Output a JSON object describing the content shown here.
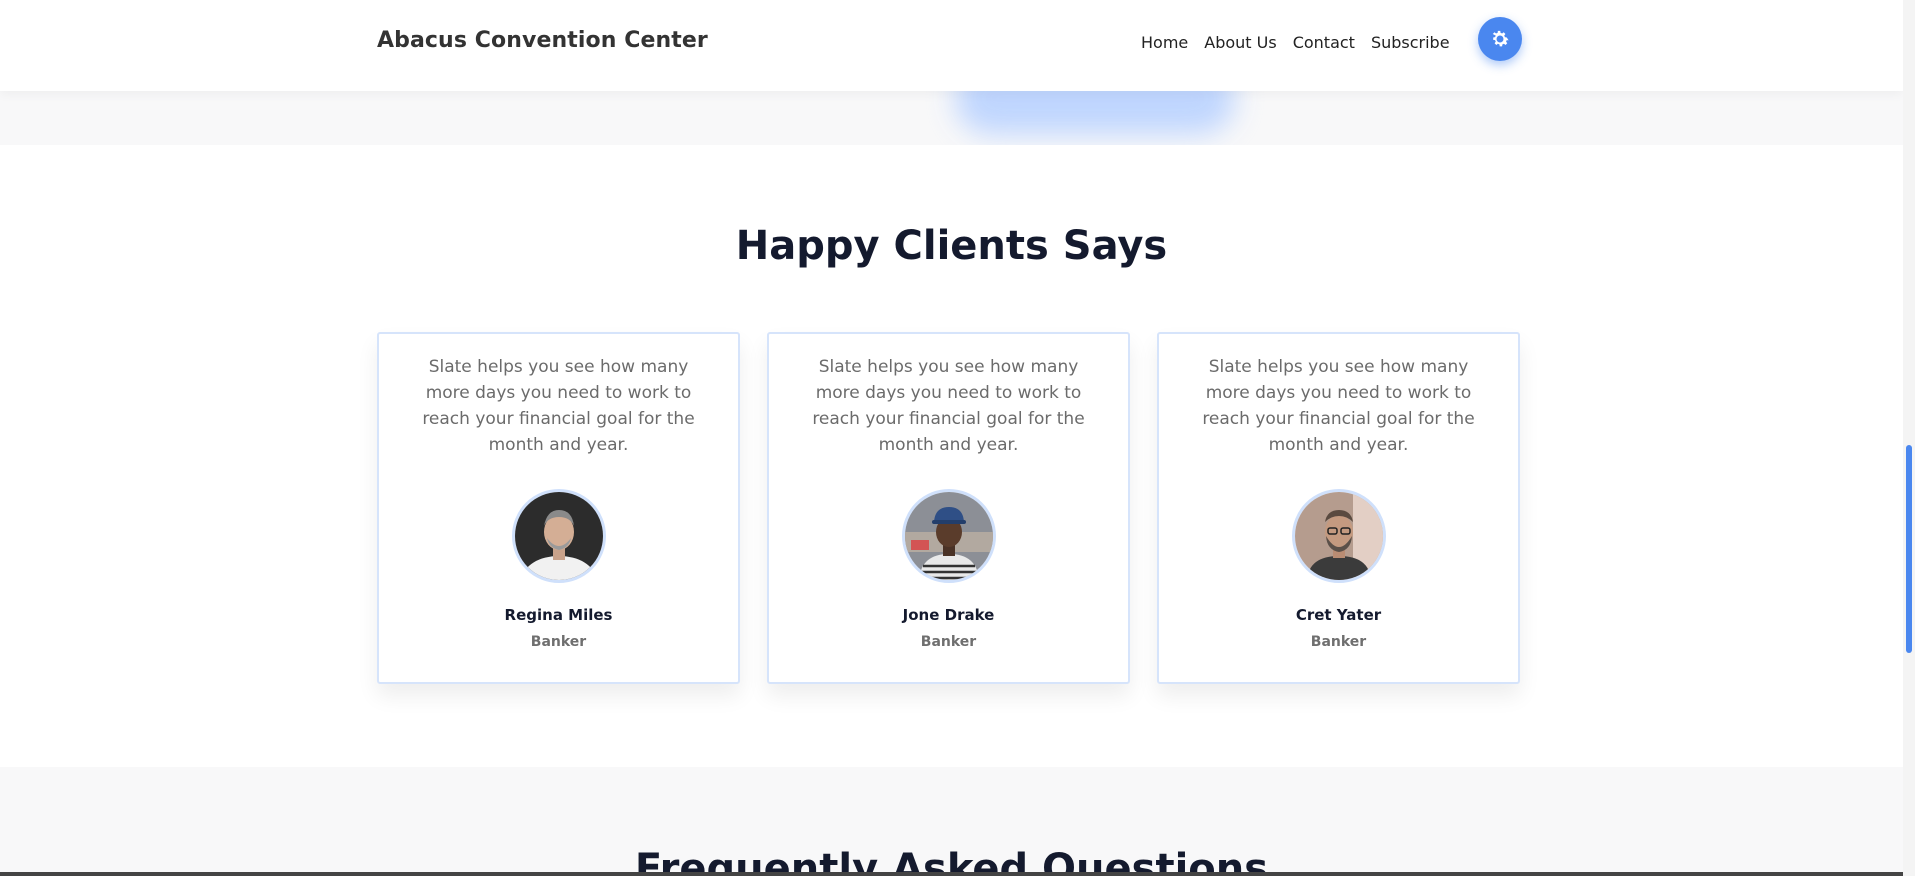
{
  "header": {
    "brand": "Abacus Convention Center",
    "nav": [
      "Home",
      "About Us",
      "Contact",
      "Subscribe"
    ],
    "theme_toggle_icon": "gear-icon",
    "accent_color": "#4a87ef"
  },
  "testimonials": {
    "title": "Happy Clients Says",
    "cards": [
      {
        "quote": "Slate helps you see how many more days you need to work to reach your financial goal for the month and year.",
        "name": "Regina Miles",
        "role": "Banker"
      },
      {
        "quote": "Slate helps you see how many more days you need to work to reach your financial goal for the month and year.",
        "name": "Jone Drake",
        "role": "Banker"
      },
      {
        "quote": "Slate helps you see how many more days you need to work to reach your financial goal for the month and year.",
        "name": "Cret Yater",
        "role": "Banker"
      }
    ]
  },
  "faq": {
    "title": "Frequently Asked Questions"
  }
}
